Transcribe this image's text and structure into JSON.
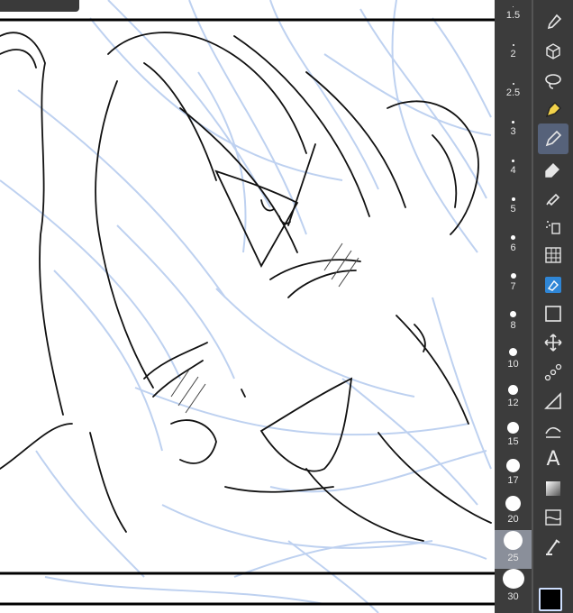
{
  "brush_sizes": [
    {
      "label": "1.5",
      "dot": 1
    },
    {
      "label": "2",
      "dot": 2
    },
    {
      "label": "2.5",
      "dot": 2
    },
    {
      "label": "3",
      "dot": 3
    },
    {
      "label": "4",
      "dot": 3
    },
    {
      "label": "5",
      "dot": 4
    },
    {
      "label": "6",
      "dot": 5
    },
    {
      "label": "7",
      "dot": 6
    },
    {
      "label": "8",
      "dot": 7
    },
    {
      "label": "10",
      "dot": 9
    },
    {
      "label": "12",
      "dot": 11
    },
    {
      "label": "15",
      "dot": 13
    },
    {
      "label": "17",
      "dot": 15
    },
    {
      "label": "20",
      "dot": 17
    },
    {
      "label": "25",
      "dot": 21
    },
    {
      "label": "30",
      "dot": 24
    }
  ],
  "selected_brush_size": "25",
  "tools": [
    {
      "name": "eyedropper-tool-icon"
    },
    {
      "name": "object-select-tool-icon"
    },
    {
      "name": "lasso-tool-icon"
    },
    {
      "name": "pen-tool-icon"
    },
    {
      "name": "pencil-tool-icon",
      "selected": true
    },
    {
      "name": "eraser-tool-icon"
    },
    {
      "name": "brush-tool-icon"
    },
    {
      "name": "airbrush-tool-icon"
    },
    {
      "name": "frame-grid-tool-icon"
    },
    {
      "name": "fill-tool-icon"
    },
    {
      "name": "rectangle-tool-icon"
    },
    {
      "name": "move-tool-icon"
    },
    {
      "name": "decoration-tool-icon"
    },
    {
      "name": "ruler-tool-icon"
    },
    {
      "name": "correct-line-tool-icon"
    },
    {
      "name": "text-tool-icon",
      "glyph": "A"
    },
    {
      "name": "gradient-tool-icon"
    },
    {
      "name": "blend-tool-icon"
    },
    {
      "name": "paint-tool-icon"
    }
  ],
  "current_color": "#000000",
  "accent_color": "#56627a",
  "panel_color": "#3c3c3c"
}
